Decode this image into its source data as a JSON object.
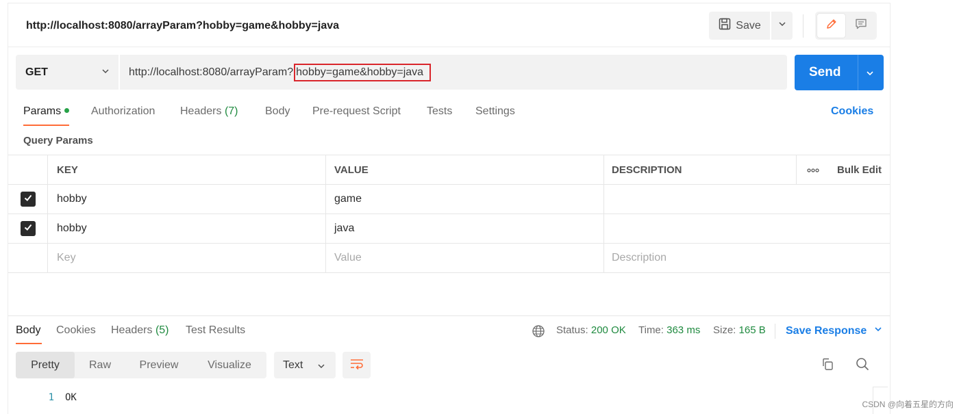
{
  "request": {
    "title": "http://localhost:8080/arrayParam?hobby=game&hobby=java",
    "save_label": "Save",
    "method": "GET",
    "url_base": "http://localhost:8080/arrayParam?",
    "url_query": "hobby=game&hobby=java",
    "send_label": "Send"
  },
  "tabs": {
    "params": "Params",
    "authorization": "Authorization",
    "headers": "Headers",
    "headers_count": "(7)",
    "body": "Body",
    "prerequest": "Pre-request Script",
    "tests": "Tests",
    "settings": "Settings",
    "cookies": "Cookies"
  },
  "query_params": {
    "title": "Query Params",
    "headers": {
      "key": "KEY",
      "value": "VALUE",
      "description": "DESCRIPTION",
      "bulk_edit": "Bulk Edit"
    },
    "rows": [
      {
        "checked": true,
        "key": "hobby",
        "value": "game",
        "description": ""
      },
      {
        "checked": true,
        "key": "hobby",
        "value": "java",
        "description": ""
      }
    ],
    "placeholders": {
      "key": "Key",
      "value": "Value",
      "description": "Description"
    }
  },
  "response": {
    "tabs": {
      "body": "Body",
      "cookies": "Cookies",
      "headers": "Headers",
      "headers_count": "(5)",
      "test_results": "Test Results"
    },
    "status_label": "Status:",
    "status_value": "200 OK",
    "time_label": "Time:",
    "time_value": "363 ms",
    "size_label": "Size:",
    "size_value": "165 B",
    "save_response": "Save Response",
    "views": {
      "pretty": "Pretty",
      "raw": "Raw",
      "preview": "Preview",
      "visualize": "Visualize"
    },
    "format": "Text",
    "lines": [
      {
        "number": "1",
        "text": "OK"
      }
    ]
  },
  "watermark": "CSDN @向着五星的方向",
  "colors": {
    "accent_orange": "#ff6c37",
    "primary_blue": "#1a7ee6",
    "success_green": "#1f8a3f",
    "highlight_red": "#d9252b"
  },
  "icons": [
    "save-icon",
    "chevron-down-icon",
    "edit-pencil-icon",
    "comment-icon",
    "more-horizontal-icon",
    "checkmark-icon",
    "globe-icon",
    "wrap-lines-icon",
    "copy-icon",
    "search-icon"
  ]
}
